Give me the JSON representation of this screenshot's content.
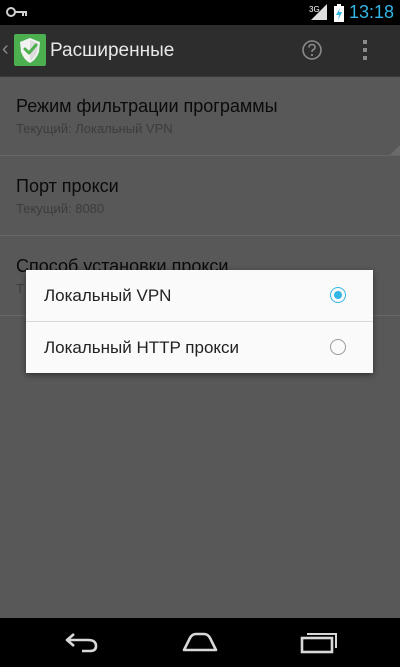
{
  "status_bar": {
    "time": "13:18",
    "network": "3G",
    "icons": [
      "key-icon",
      "signal-icon",
      "battery-charging-icon"
    ]
  },
  "app_bar": {
    "title": "Расширенные",
    "icons": [
      "back-chevron-icon",
      "app-shield-logo",
      "help-icon",
      "overflow-menu-icon"
    ]
  },
  "preferences": [
    {
      "title": "Режим фильтрации программы",
      "summary": "Текущий: Локальный VPN"
    },
    {
      "title": "Порт прокси",
      "summary": "Текущий: 8080"
    },
    {
      "title": "Способ установки прокси",
      "summary": "Т"
    }
  ],
  "dialog": {
    "options": [
      {
        "label": "Локальный VPN",
        "selected": true
      },
      {
        "label": "Локальный HTTP прокси",
        "selected": false
      }
    ]
  },
  "nav_bar": {
    "icons": [
      "back-icon",
      "home-icon",
      "recents-icon"
    ]
  },
  "colors": {
    "accent": "#33b5e5",
    "app_bar": "#2d2d2d",
    "dimmed_content": "#585858",
    "logo_green": "#4caf50"
  }
}
